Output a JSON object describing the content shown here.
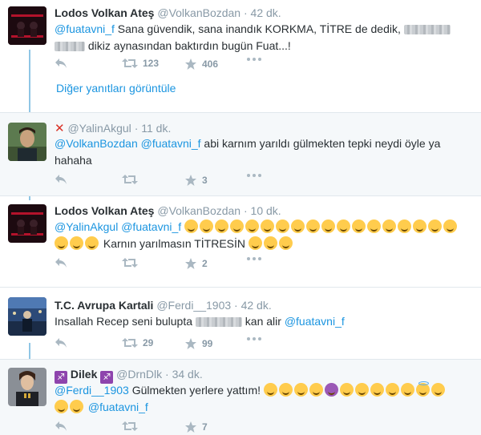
{
  "tweets": [
    {
      "name": "Lodos Volkan Ateş",
      "handle": "@VolkanBozdan",
      "time": "· 42 dk.",
      "mention": "@fuatavni_f",
      "text1": " Sana güvendik, sana inandık KORKMA, TİTRE de dedik, ",
      "text2": " dikiz aynasından baktırdın bugün Fuat...!",
      "retweets": "123",
      "likes": "406"
    },
    {
      "handle": "@YalinAkgul",
      "time": "· 11 dk.",
      "mention1": "@VolkanBozdan",
      "mention2": "@fuatavni_f",
      "text": " abi karnım yarıldı gülmekten tepki neydi öyle ya hahaha",
      "likes": "3"
    },
    {
      "name": "Lodos Volkan Ateş",
      "handle": "@VolkanBozdan",
      "time": "· 10 dk.",
      "mention1": "@YalinAkgul",
      "mention2": "@fuatavni_f",
      "text": " Karnın yarılmasın TİTRESİN ",
      "likes": "2"
    },
    {
      "name": "T.C. Avrupa Kartali",
      "handle": "@Ferdi__1903",
      "time": "· 42 dk.",
      "text1": "Insallah Recep seni bulupta ",
      "text2": " kan alir ",
      "mention": "@fuatavni_f",
      "retweets": "29",
      "likes": "99"
    },
    {
      "name": "Dilek",
      "handle": "@DrnDlk",
      "time": "· 34 dk.",
      "mention1": "@Ferdi__1903",
      "text": " Gülmekten yerlere yattım! ",
      "mention2": "@fuatavni_f",
      "likes": "7"
    }
  ],
  "more_replies": "Diğer yanıtları görüntüle",
  "icons": {
    "reply": "reply-icon",
    "retweet": "retweet-icon",
    "like": "star-icon",
    "more": "more-icon"
  },
  "colors": {
    "link": "#1b95e0",
    "meta": "#8899a6",
    "thread": "#8fc6e5"
  }
}
